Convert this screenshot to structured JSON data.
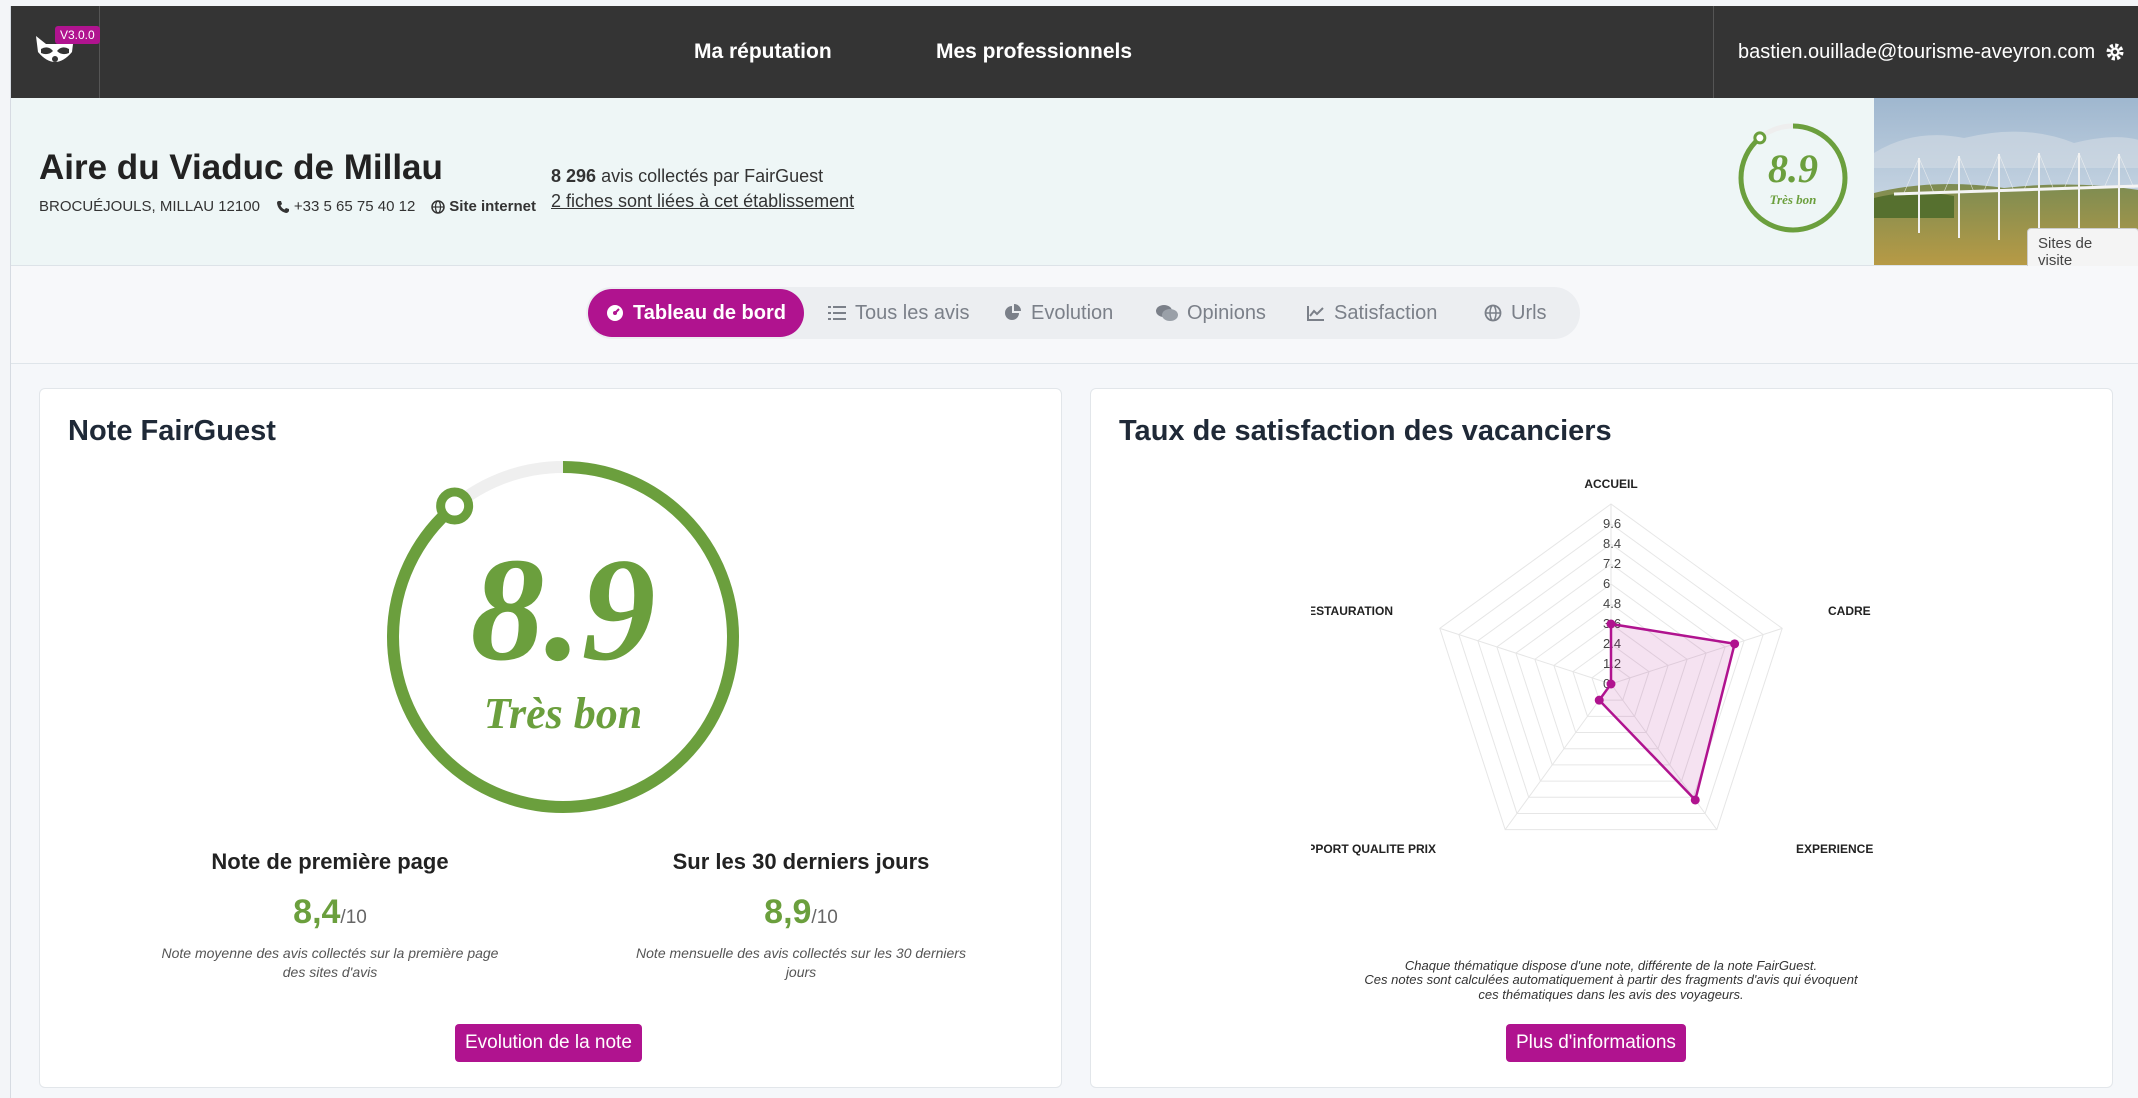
{
  "nav": {
    "version": "V3.0.0",
    "links": [
      "Ma réputation",
      "Mes professionnels"
    ],
    "user_email": "bastien.ouillade@tourisme-aveyron.com"
  },
  "establishment": {
    "name": "Aire du Viaduc de Millau",
    "address": "BROCUÉJOULS, MILLAU 12100",
    "phone": "+33 5 65 75 40 12",
    "website_label": "Site internet",
    "reviews_count": "8 296",
    "reviews_suffix": "avis collectés par FairGuest",
    "linked_fiches": "2 fiches sont liées à cet établissement",
    "score": "8.9",
    "score_label": "Très bon",
    "sites_button": "Sites de visite"
  },
  "tabs": [
    {
      "label": "Tableau de bord",
      "icon": "dashboard-icon",
      "active": true
    },
    {
      "label": "Tous les avis",
      "icon": "list-icon",
      "active": false
    },
    {
      "label": "Evolution",
      "icon": "pie-chart-icon",
      "active": false
    },
    {
      "label": "Opinions",
      "icon": "comments-icon",
      "active": false
    },
    {
      "label": "Satisfaction",
      "icon": "line-chart-icon",
      "active": false
    },
    {
      "label": "Urls",
      "icon": "globe-icon",
      "active": false
    }
  ],
  "note_card": {
    "title": "Note FairGuest",
    "score": "8.9",
    "score_label": "Très bon",
    "score_value": 8.9,
    "score_max": 10,
    "first_page": {
      "title": "Note de première page",
      "value": "8,4",
      "max": "/10",
      "desc": "Note moyenne des avis collectés sur la première page des sites d'avis"
    },
    "last_30": {
      "title": "Sur les 30 derniers jours",
      "value": "8,9",
      "max": "/10",
      "desc": "Note mensuelle des avis collectés sur les 30 derniers jours"
    },
    "button": "Evolution de la note"
  },
  "satisfaction_card": {
    "title": "Taux de satisfaction des vacanciers",
    "note_line1": "Chaque thématique dispose d'une note, différente de la note FairGuest.",
    "note_line2": "Ces notes sont calculées automatiquement à partir des fragments d'avis qui évoquent",
    "note_line3": "ces thématiques dans les avis des voyageurs.",
    "button": "Plus d'informations"
  },
  "chart_data": {
    "type": "radar",
    "categories": [
      "ACCUEIL",
      "CADRE",
      "EXPERIENCE",
      "RAPPORT QUALITE PRIX",
      "RESTAURATION"
    ],
    "values": [
      3.6,
      7.8,
      8.6,
      1.2,
      0.0
    ],
    "scale_ticks": [
      "0",
      "1.2",
      "2.4",
      "3.6",
      "4.8",
      "6",
      "7.2",
      "8.4",
      "9.6"
    ],
    "r_max": 10.8,
    "color": "#b0138f"
  },
  "colors": {
    "accent": "#b0138f",
    "score_green": "#6b9f3d",
    "navbar": "#343434"
  }
}
